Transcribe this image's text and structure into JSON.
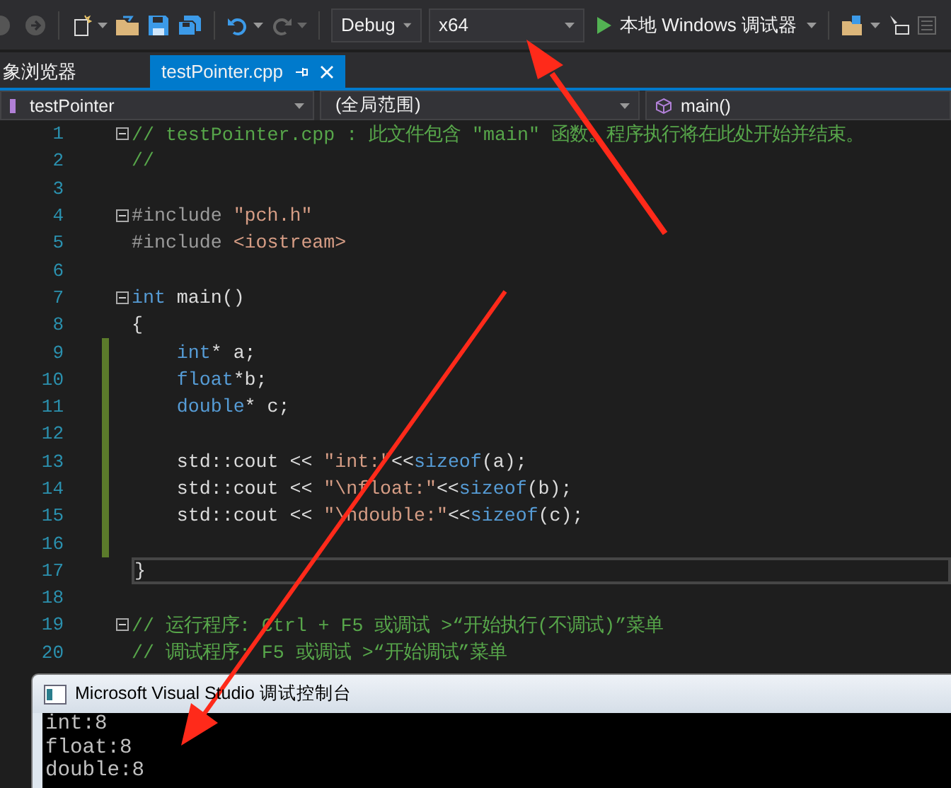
{
  "toolbar": {
    "configuration": "Debug",
    "platform": "x64",
    "run_label": "本地 Windows 调试器"
  },
  "tabs": [
    {
      "label": "象浏览器",
      "selected": false
    },
    {
      "label": "testPointer.cpp",
      "selected": true
    }
  ],
  "navigation": {
    "project": "testPointer",
    "scope": "(全局范围)",
    "member": "main()"
  },
  "editor": {
    "lines": [
      {
        "number": "1",
        "foldable": true,
        "changed": false,
        "current": false,
        "tokens": [
          {
            "kind": "comment",
            "text": "// testPointer.cpp : 此文件包含 \"main\" 函数。程序执行将在此处开始并结束。"
          }
        ]
      },
      {
        "number": "2",
        "foldable": false,
        "changed": false,
        "current": false,
        "tokens": [
          {
            "kind": "comment",
            "text": "//"
          }
        ]
      },
      {
        "number": "3",
        "foldable": false,
        "changed": false,
        "current": false
      },
      {
        "number": "4",
        "foldable": true,
        "changed": false,
        "current": false,
        "tokens": [
          {
            "kind": "preprocessor",
            "text": "#include "
          },
          {
            "kind": "string",
            "text": "\"pch.h\""
          }
        ]
      },
      {
        "number": "5",
        "foldable": false,
        "changed": false,
        "current": false,
        "tokens": [
          {
            "kind": "preprocessor",
            "text": "#include "
          },
          {
            "kind": "string",
            "text": "<iostream>"
          }
        ]
      },
      {
        "number": "6",
        "foldable": false,
        "changed": false,
        "current": false
      },
      {
        "number": "7",
        "foldable": true,
        "changed": false,
        "current": false,
        "tokens": [
          {
            "kind": "keyword",
            "text": "int"
          },
          {
            "kind": "plain",
            "text": " main()"
          }
        ]
      },
      {
        "number": "8",
        "foldable": false,
        "changed": false,
        "current": false,
        "tokens": [
          {
            "kind": "plain",
            "text": "{"
          }
        ]
      },
      {
        "number": "9",
        "foldable": false,
        "changed": true,
        "current": false,
        "tokens": [
          {
            "kind": "keyword",
            "text": "    int"
          },
          {
            "kind": "plain",
            "text": "* a;"
          }
        ]
      },
      {
        "number": "10",
        "foldable": false,
        "changed": true,
        "current": false,
        "tokens": [
          {
            "kind": "keyword",
            "text": "    float"
          },
          {
            "kind": "plain",
            "text": "*b;"
          }
        ]
      },
      {
        "number": "11",
        "foldable": false,
        "changed": true,
        "current": false,
        "tokens": [
          {
            "kind": "keyword",
            "text": "    double"
          },
          {
            "kind": "plain",
            "text": "* c;"
          }
        ]
      },
      {
        "number": "12",
        "foldable": false,
        "changed": true,
        "current": false
      },
      {
        "number": "13",
        "foldable": false,
        "changed": true,
        "current": false,
        "tokens": [
          {
            "kind": "plain",
            "text": "    std::cout << "
          },
          {
            "kind": "string",
            "text": "\"int:\""
          },
          {
            "kind": "plain",
            "text": "<<"
          },
          {
            "kind": "keyword",
            "text": "sizeof"
          },
          {
            "kind": "plain",
            "text": "(a);"
          }
        ]
      },
      {
        "number": "14",
        "foldable": false,
        "changed": true,
        "current": false,
        "tokens": [
          {
            "kind": "plain",
            "text": "    std::cout << "
          },
          {
            "kind": "string",
            "text": "\"\\nfloat:\""
          },
          {
            "kind": "plain",
            "text": "<<"
          },
          {
            "kind": "keyword",
            "text": "sizeof"
          },
          {
            "kind": "plain",
            "text": "(b);"
          }
        ]
      },
      {
        "number": "15",
        "foldable": false,
        "changed": true,
        "current": false,
        "tokens": [
          {
            "kind": "plain",
            "text": "    std::cout << "
          },
          {
            "kind": "string",
            "text": "\"\\ndouble:\""
          },
          {
            "kind": "plain",
            "text": "<<"
          },
          {
            "kind": "keyword",
            "text": "sizeof"
          },
          {
            "kind": "plain",
            "text": "(c);"
          }
        ]
      },
      {
        "number": "16",
        "foldable": false,
        "changed": true,
        "current": false
      },
      {
        "number": "17",
        "foldable": false,
        "changed": false,
        "current": true,
        "tokens": [
          {
            "kind": "plain",
            "text": "}"
          }
        ]
      },
      {
        "number": "18",
        "foldable": false,
        "changed": false,
        "current": false
      },
      {
        "number": "19",
        "foldable": true,
        "changed": false,
        "current": false,
        "tokens": [
          {
            "kind": "comment",
            "text": "// 运行程序: Ctrl + F5 或调试 >“开始执行(不调试)”菜单"
          }
        ]
      },
      {
        "number": "20",
        "foldable": false,
        "changed": false,
        "current": false,
        "tokens": [
          {
            "kind": "comment",
            "text": "// 调试程序: F5 或调试 >“开始调试”菜单"
          }
        ]
      }
    ]
  },
  "console": {
    "title": "Microsoft Visual Studio 调试控制台",
    "lines": [
      "int:8",
      "float:8",
      "double:8"
    ]
  }
}
